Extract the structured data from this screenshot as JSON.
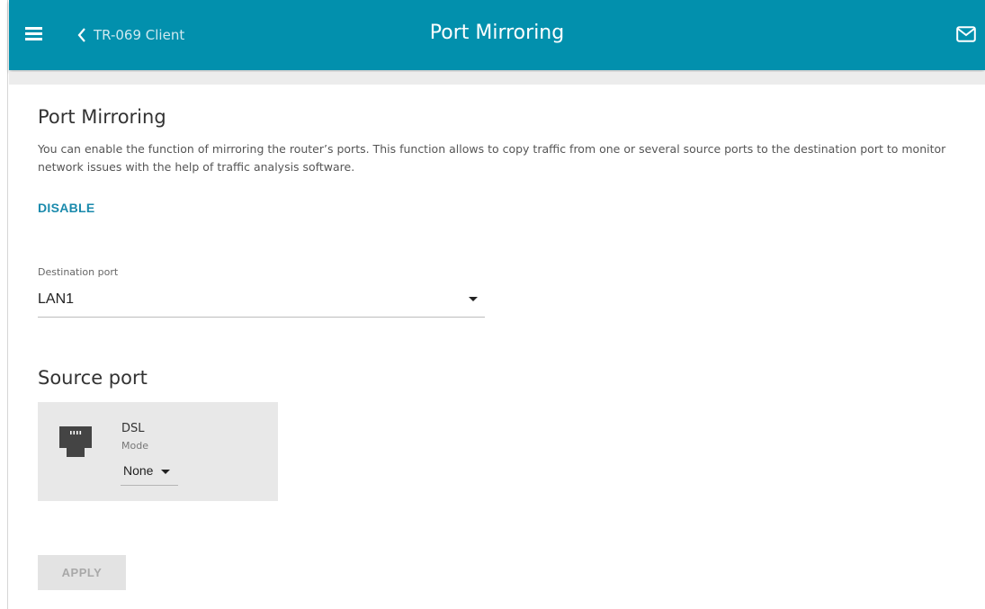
{
  "header": {
    "back_label": "TR-069 Client",
    "title": "Port Mirroring",
    "color": "#0290ad"
  },
  "main": {
    "heading": "Port Mirroring",
    "description": "You can enable the function of mirroring the router’s ports. This function allows to copy traffic from one or several source ports to the destination port to monitor network issues with the help of traffic analysis software.",
    "disable_label": "DISABLE",
    "destination": {
      "label": "Destination port",
      "value": "LAN1"
    },
    "source_heading": "Source port",
    "source_ports": [
      {
        "name": "DSL",
        "mode_label": "Mode",
        "mode_value": "None",
        "icon": "ethernet-port-icon"
      }
    ],
    "apply_label": "APPLY"
  },
  "icons": {
    "menu": "hamburger-menu-icon",
    "back": "chevron-left-icon",
    "mail": "envelope-icon"
  },
  "colors": {
    "accent": "#1a8aac",
    "card": "#e8e8e8",
    "disabled_button": "#e3e3e3"
  }
}
